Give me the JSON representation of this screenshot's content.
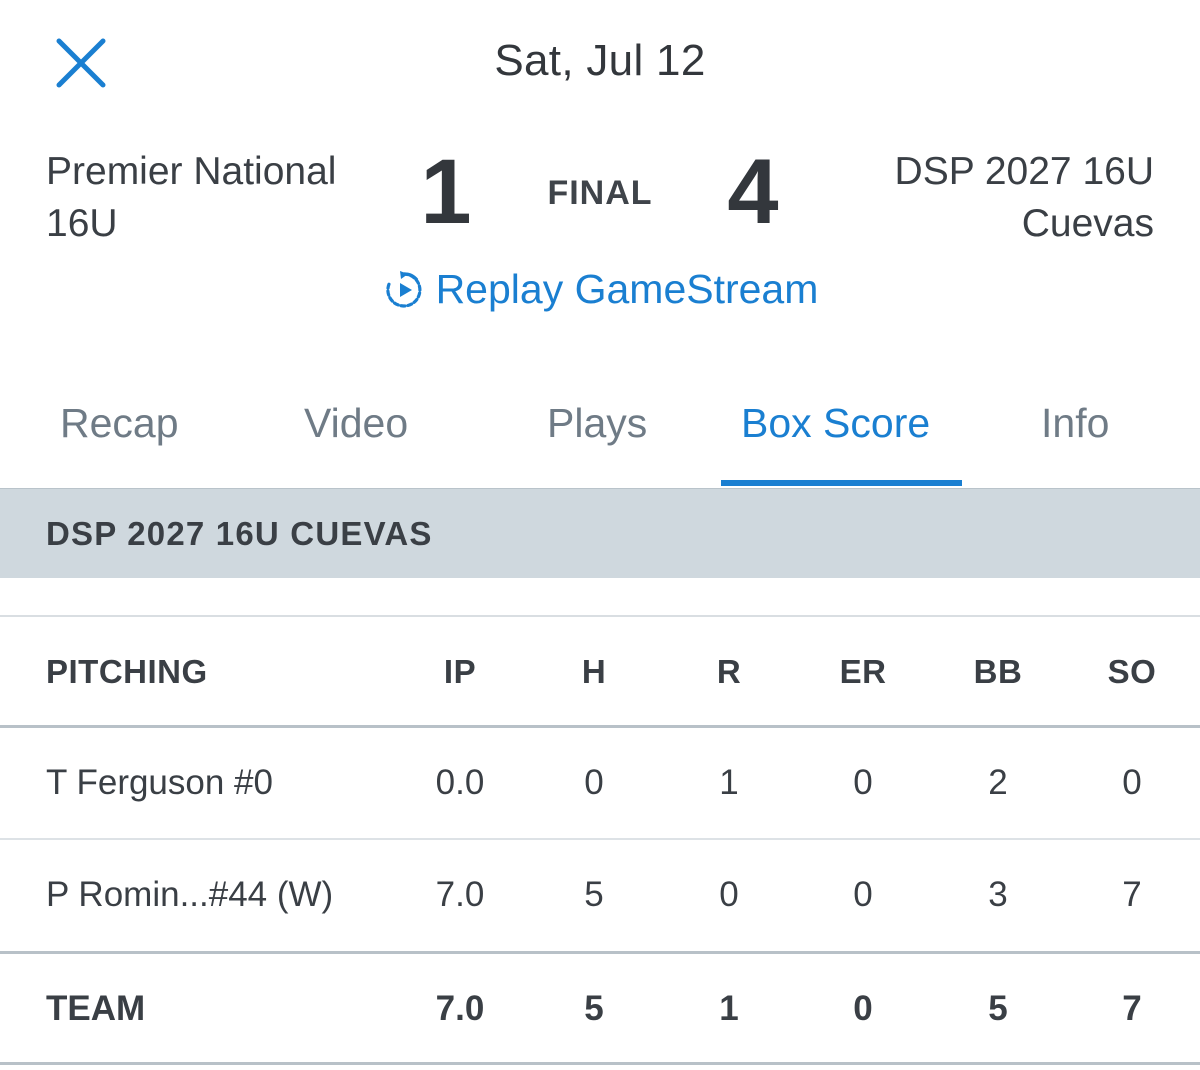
{
  "header": {
    "date": "Sat, Jul 12",
    "close_icon": "close-icon"
  },
  "scoreboard": {
    "away_team": "Premier National 16U",
    "away_score": "1",
    "status": "FINAL",
    "home_score": "4",
    "home_team": "DSP 2027 16U Cuevas",
    "replay_label": "Replay GameStream",
    "replay_icon": "replay-icon"
  },
  "tabs": [
    {
      "label": "Recap",
      "active": false
    },
    {
      "label": "Video",
      "active": false
    },
    {
      "label": "Plays",
      "active": false
    },
    {
      "label": "Box Score",
      "active": true
    },
    {
      "label": "Info",
      "active": false
    }
  ],
  "section": {
    "team_name": "DSP 2027 16U CUEVAS"
  },
  "pitching": {
    "columns": [
      "PITCHING",
      "IP",
      "H",
      "R",
      "ER",
      "BB",
      "SO"
    ],
    "rows": [
      {
        "name": "T Ferguson #0",
        "ip": "0.0",
        "h": "0",
        "r": "1",
        "er": "0",
        "bb": "2",
        "so": "0"
      },
      {
        "name": "P Romin...#44 (W)",
        "ip": "7.0",
        "h": "5",
        "r": "0",
        "er": "0",
        "bb": "3",
        "so": "7"
      }
    ],
    "team": {
      "name": "TEAM",
      "ip": "7.0",
      "h": "5",
      "r": "1",
      "er": "0",
      "bb": "5",
      "so": "7"
    }
  },
  "colors": {
    "accent": "#1a7fd1",
    "band": "#cfd8de",
    "text": "#3a3f45",
    "tab_inactive": "#6f7b86"
  }
}
